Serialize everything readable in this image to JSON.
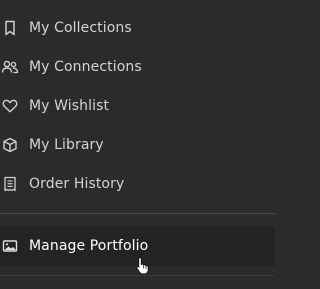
{
  "menu": {
    "items": [
      {
        "label": "My Collections",
        "icon": "bookmark-icon"
      },
      {
        "label": "My Connections",
        "icon": "users-icon"
      },
      {
        "label": "My Wishlist",
        "icon": "heart-icon"
      },
      {
        "label": "My Library",
        "icon": "box-icon"
      },
      {
        "label": "Order History",
        "icon": "receipt-icon"
      }
    ],
    "footer_item": {
      "label": "Manage Portfolio",
      "icon": "image-icon"
    }
  },
  "colors": {
    "background": "#2b2b2b",
    "text": "#d4d4d4",
    "active_background": "#232323",
    "divider": "#4a4a4a"
  }
}
